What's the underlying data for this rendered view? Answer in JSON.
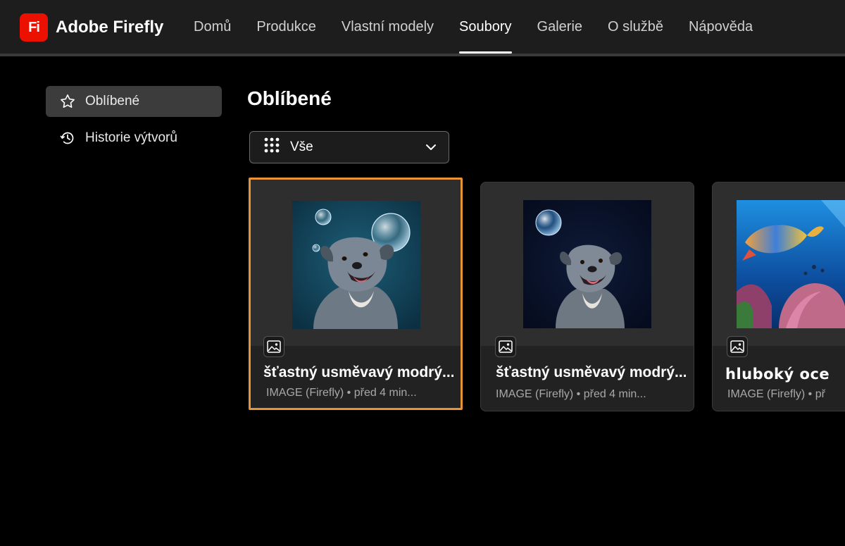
{
  "app": {
    "logo_mark": "Fi",
    "name": "Adobe Firefly",
    "brand_color": "#eb1000"
  },
  "nav": {
    "items": [
      {
        "label": "Domů"
      },
      {
        "label": "Produkce"
      },
      {
        "label": "Vlastní modely"
      },
      {
        "label": "Soubory",
        "active": true
      },
      {
        "label": "Galerie"
      },
      {
        "label": "O službě"
      },
      {
        "label": "Nápověda"
      }
    ]
  },
  "sidebar": {
    "items": [
      {
        "label": "Oblíbené",
        "icon": "star-icon",
        "active": true
      },
      {
        "label": "Historie výtvorů",
        "icon": "history-icon"
      }
    ]
  },
  "main": {
    "title": "Oblíbené",
    "filter": {
      "selected": "Vše",
      "icon": "grid-icon"
    },
    "cards": [
      {
        "title": "šťastný usměvavý modrý...",
        "meta": "IMAGE (Firefly) • před 4 min...",
        "type_icon": "image-icon",
        "selected": true
      },
      {
        "title": "šťastný usměvavý modrý...",
        "meta": "IMAGE (Firefly) • před 4 min...",
        "type_icon": "image-icon"
      },
      {
        "title": "hluboký oce",
        "meta": "IMAGE (Firefly) • př",
        "type_icon": "image-icon"
      }
    ]
  },
  "colors": {
    "selection_border": "#e8923a",
    "topbar_bg": "#1d1d1d",
    "card_bg": "#2e2e2e"
  }
}
